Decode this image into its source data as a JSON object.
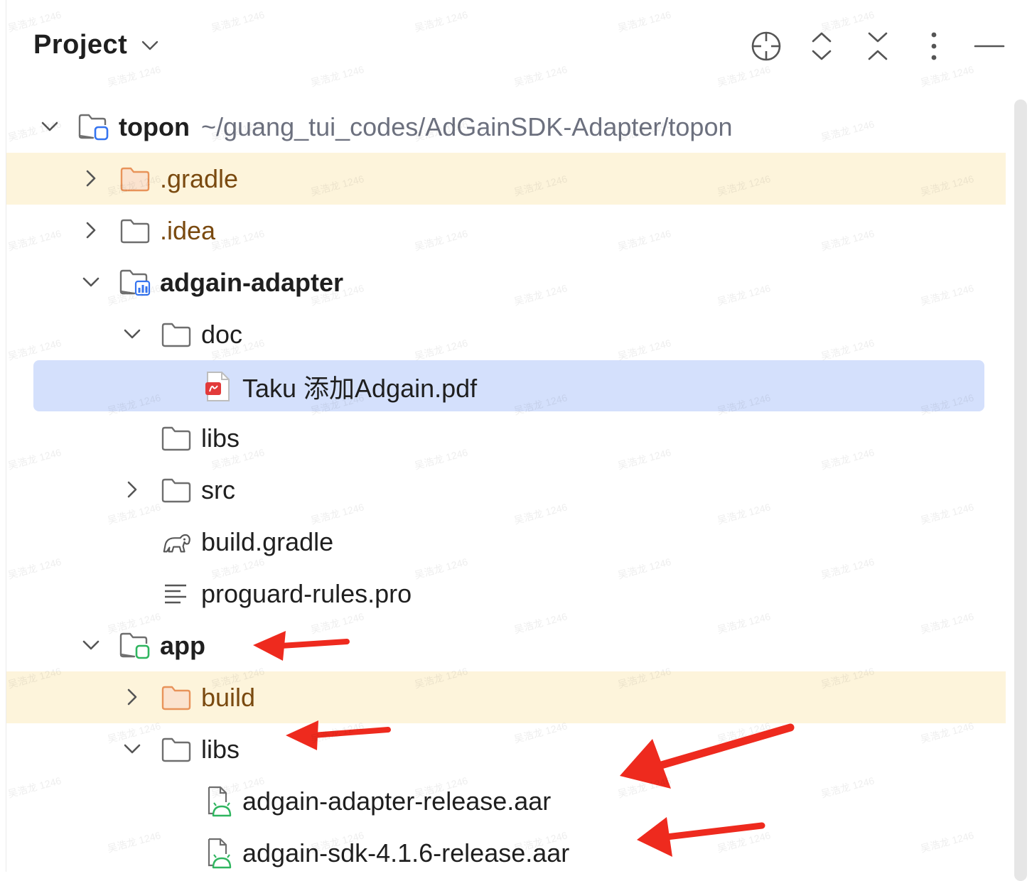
{
  "header": {
    "title": "Project",
    "toolbar_icons": [
      "locate-icon",
      "expand-all-icon",
      "collapse-all-icon",
      "more-options-icon",
      "minimize-icon"
    ]
  },
  "tree": [
    {
      "label": "topon",
      "hint": "~/guang_tui_codes/AdGainSDK-Adapter/topon",
      "depth": 0,
      "expanded": true,
      "icon": "module-folder-icon",
      "bold": true,
      "excluded": false,
      "selected": false
    },
    {
      "label": ".gradle",
      "depth": 1,
      "expanded": false,
      "icon": "excluded-folder-icon",
      "excluded": true,
      "brown": true
    },
    {
      "label": ".idea",
      "depth": 1,
      "expanded": false,
      "icon": "folder-icon",
      "brown": true
    },
    {
      "label": "adgain-adapter",
      "depth": 1,
      "expanded": true,
      "icon": "library-module-folder-icon",
      "bold": true
    },
    {
      "label": "doc",
      "depth": 2,
      "expanded": true,
      "icon": "folder-icon"
    },
    {
      "label": "Taku 添加Adgain.pdf",
      "depth": 3,
      "icon": "pdf-file-icon",
      "selected": true
    },
    {
      "label": "libs",
      "depth": 2,
      "icon": "folder-icon",
      "leaf": true
    },
    {
      "label": "src",
      "depth": 2,
      "expanded": false,
      "icon": "folder-icon"
    },
    {
      "label": "build.gradle",
      "depth": 2,
      "icon": "gradle-file-icon",
      "leaf": true
    },
    {
      "label": "proguard-rules.pro",
      "depth": 2,
      "icon": "text-file-icon",
      "leaf": true
    },
    {
      "label": "app",
      "depth": 1,
      "expanded": true,
      "icon": "app-module-folder-icon",
      "bold": true
    },
    {
      "label": "build",
      "depth": 2,
      "expanded": false,
      "icon": "excluded-folder-icon",
      "excluded": true,
      "brown": true
    },
    {
      "label": "libs",
      "depth": 2,
      "expanded": true,
      "icon": "folder-icon"
    },
    {
      "label": "adgain-adapter-release.aar",
      "depth": 3,
      "icon": "aar-file-icon"
    },
    {
      "label": "adgain-sdk-4.1.6-release.aar",
      "depth": 3,
      "icon": "aar-file-icon"
    }
  ],
  "colors": {
    "excluded_bg": "#fdf4db",
    "selected_bg": "#d4e0fc",
    "arrow": "#ee2a1e",
    "module_badge_blue": "#3574f0",
    "module_badge_green": "#2fb55f",
    "folder_orange": "#e8935a",
    "pdf_red": "#e23a3a"
  },
  "watermark": "吴浩龙 1246"
}
